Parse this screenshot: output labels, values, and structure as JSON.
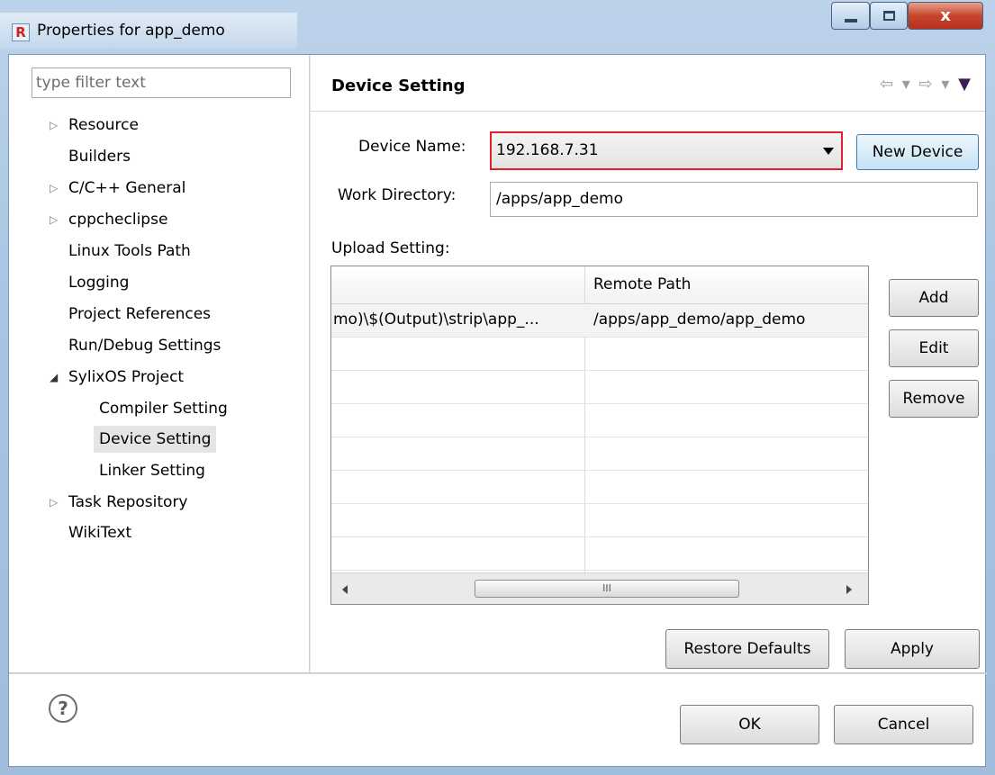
{
  "window": {
    "title": "Properties for app_demo",
    "app_icon_letter": "R",
    "close_glyph": "x"
  },
  "filter": {
    "placeholder": "type filter text"
  },
  "tree": {
    "items": [
      {
        "label": "Resource",
        "twisty": "▷"
      },
      {
        "label": "Builders"
      },
      {
        "label": "C/C++ General",
        "twisty": "▷"
      },
      {
        "label": "cppcheclipse",
        "twisty": "▷"
      },
      {
        "label": "Linux Tools Path"
      },
      {
        "label": "Logging"
      },
      {
        "label": "Project References"
      },
      {
        "label": "Run/Debug Settings"
      },
      {
        "label": "SylixOS Project",
        "twisty": "◢"
      },
      {
        "label": "Compiler Setting"
      },
      {
        "label": "Device Setting",
        "selected": true
      },
      {
        "label": "Linker Setting"
      },
      {
        "label": "Task Repository",
        "twisty": "▷"
      },
      {
        "label": "WikiText"
      }
    ]
  },
  "page": {
    "title": "Device Setting",
    "nav": {
      "back": "⇦",
      "back_menu": "▾",
      "forward": "⇨",
      "forward_menu": "▾",
      "view_menu": "▼"
    },
    "device_name_label": "Device Name:",
    "device_name_value": "192.168.7.31",
    "new_device_label": "New Device",
    "work_dir_label": "Work Directory:",
    "work_dir_value": "/apps/app_demo",
    "upload_label": "Upload Setting:",
    "table": {
      "columns": [
        "",
        "Remote Path"
      ],
      "rows": [
        [
          "mo)\\$(Output)\\strip\\app_...",
          "/apps/app_demo/app_demo"
        ]
      ],
      "scroll_thumb_glyph": "III"
    },
    "add_label": "Add",
    "edit_label": "Edit",
    "remove_label": "Remove",
    "restore_label": "Restore Defaults",
    "apply_label": "Apply"
  },
  "footer": {
    "help_glyph": "?",
    "ok_label": "OK",
    "cancel_label": "Cancel"
  }
}
